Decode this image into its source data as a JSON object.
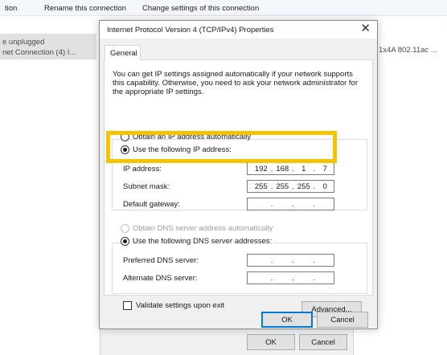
{
  "background": {
    "toolbar": {
      "item0": "tion",
      "item1": "Rename this connection",
      "item2": "Change settings of this connection"
    },
    "connection": {
      "status": "e unplugged",
      "name": "net Connection (4) I..."
    },
    "wifi_adapter": "1x4A 802.11ac ...",
    "ok_label": "OK",
    "cancel_label": "Cancel"
  },
  "dialog": {
    "title": "Internet Protocol Version 4 (TCP/IPv4) Properties",
    "close_icon": "close-icon",
    "tab_general": "General",
    "description": "You can get IP settings assigned automatically if your network supports this capability. Otherwise, you need to ask your network administrator for the appropriate IP settings.",
    "ip_mode": {
      "auto_label": "Obtain an IP address automatically",
      "manual_label": "Use the following IP address:",
      "selected": "manual"
    },
    "ip_address": {
      "label": "IP address:",
      "octets": [
        "192",
        "168",
        "1",
        "7"
      ]
    },
    "subnet_mask": {
      "label": "Subnet mask:",
      "octets": [
        "255",
        "255",
        "255",
        "0"
      ]
    },
    "default_gateway": {
      "label": "Default gateway:",
      "octets": [
        "",
        "",
        "",
        ""
      ]
    },
    "dns_mode": {
      "auto_label": "Obtain DNS server address automatically",
      "manual_label": "Use the following DNS server addresses:",
      "selected": "manual"
    },
    "preferred_dns": {
      "label": "Preferred DNS server:",
      "octets": [
        "",
        "",
        "",
        ""
      ]
    },
    "alternate_dns": {
      "label": "Alternate DNS server:",
      "octets": [
        "",
        "",
        "",
        ""
      ]
    },
    "validate_label": "Validate settings upon exit",
    "validate_checked": false,
    "advanced_label": "Advanced...",
    "ok_label": "OK",
    "cancel_label": "Cancel"
  },
  "colors": {
    "highlight": "#f6c300",
    "default_button_border": "#0078d7",
    "dialog_background": "#f0f0f0"
  }
}
